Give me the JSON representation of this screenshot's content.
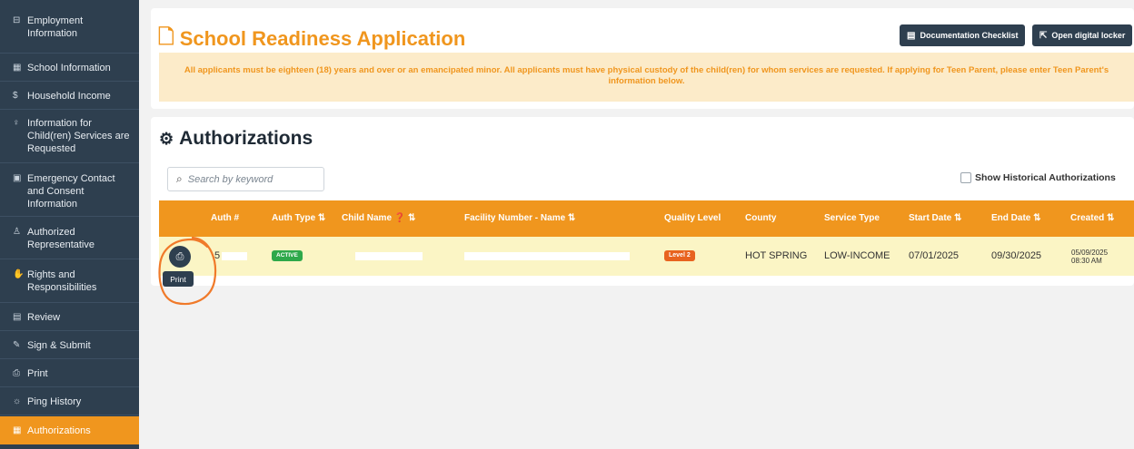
{
  "sidebar": {
    "items": [
      {
        "icon": "briefcase-icon",
        "glyph": "⊟",
        "label": "Employment Information"
      },
      {
        "icon": "school-icon",
        "glyph": "▦",
        "label": "School Information"
      },
      {
        "icon": "dollar-icon",
        "glyph": "$",
        "label": "Household Income"
      },
      {
        "icon": "child-icon",
        "glyph": "♀",
        "label": "Information for Child(ren) Services are Requested"
      },
      {
        "icon": "contact-card-icon",
        "glyph": "▣",
        "label": "Emergency Contact and Consent Information"
      },
      {
        "icon": "user-check-icon",
        "glyph": "♙",
        "label": "Authorized Representative"
      },
      {
        "icon": "hand-icon",
        "glyph": "✋",
        "label": "Rights and Responsibilities"
      },
      {
        "icon": "document-search-icon",
        "glyph": "▤",
        "label": "Review"
      },
      {
        "icon": "signature-icon",
        "glyph": "✎",
        "label": "Sign & Submit"
      },
      {
        "icon": "printer-icon",
        "glyph": "⎙",
        "label": "Print"
      },
      {
        "icon": "ping-icon",
        "glyph": "☼",
        "label": "Ping History"
      },
      {
        "icon": "authorizations-icon",
        "glyph": "▦",
        "label": "Authorizations"
      }
    ]
  },
  "header": {
    "title": "School Readiness Application",
    "doc_checklist_label": "Documentation Checklist",
    "digital_locker_label": "Open digital locker",
    "notice": "All applicants must be eighteen (18) years and over or an emancipated minor. All applicants must have physical custody of the child(ren) for whom services are requested. If applying for Teen Parent, please enter Teen Parent's information below."
  },
  "authorizations": {
    "heading": "Authorizations",
    "search_placeholder": "Search by keyword",
    "show_historical_label": "Show Historical Authorizations",
    "columns": [
      "Auth #",
      "Auth Type ⇅",
      "Child Name ❓ ⇅",
      "Facility Number - Name ⇅",
      "Quality Level",
      "County",
      "Service Type",
      "Start Date ⇅",
      "End Date ⇅",
      "Created ⇅"
    ],
    "rows": [
      {
        "auth_num": "5",
        "auth_type": "ACTIVE",
        "quality_level": "Level 2",
        "county": "HOT SPRING",
        "service_type": "LOW-INCOME",
        "start_date": "07/01/2025",
        "end_date": "09/30/2025",
        "created_date": "05/09/2025",
        "created_time": "08:30 AM"
      }
    ],
    "print_tooltip": "Print"
  },
  "colors": {
    "accent": "#f0961e",
    "sidebar": "#2e3f4f",
    "active_badge": "#2ea84a",
    "level_badge": "#e8631f",
    "row_highlight": "#fbf5c5",
    "annotation": "#f07a2a"
  }
}
